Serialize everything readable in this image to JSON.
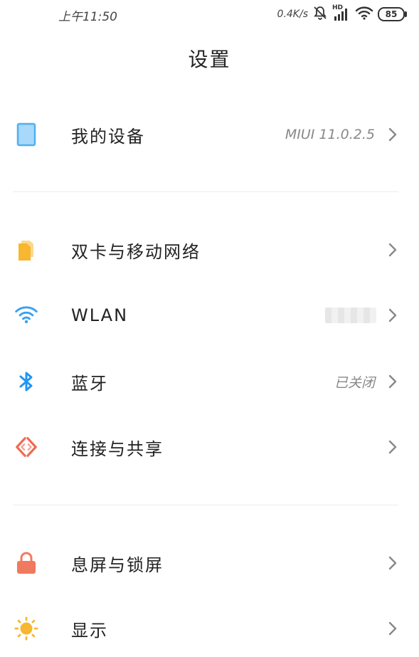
{
  "status": {
    "time": "上午11:50",
    "net_speed": "0.4K/s",
    "signal_label": "HD",
    "battery": "85"
  },
  "page": {
    "title": "设置"
  },
  "items": [
    {
      "label": "我的设备",
      "value": "MIUI 11.0.2.5",
      "icon": "phone-device-icon"
    },
    {
      "label": "双卡与移动网络",
      "value": "",
      "icon": "sim-card-icon"
    },
    {
      "label": "WLAN",
      "value": "",
      "icon": "wifi-icon"
    },
    {
      "label": "蓝牙",
      "value": "已关闭",
      "icon": "bluetooth-icon"
    },
    {
      "label": "连接与共享",
      "value": "",
      "icon": "connection-share-icon"
    },
    {
      "label": "息屏与锁屏",
      "value": "",
      "icon": "lock-icon"
    },
    {
      "label": "显示",
      "value": "",
      "icon": "sun-display-icon"
    }
  ],
  "colors": {
    "device": "#4fb0f0",
    "sim": "#f7b731",
    "wifi": "#3aa0f0",
    "bluetooth": "#2196f3",
    "share": "#f06a55",
    "lock": "#f07a5f",
    "sun": "#f7b731"
  }
}
